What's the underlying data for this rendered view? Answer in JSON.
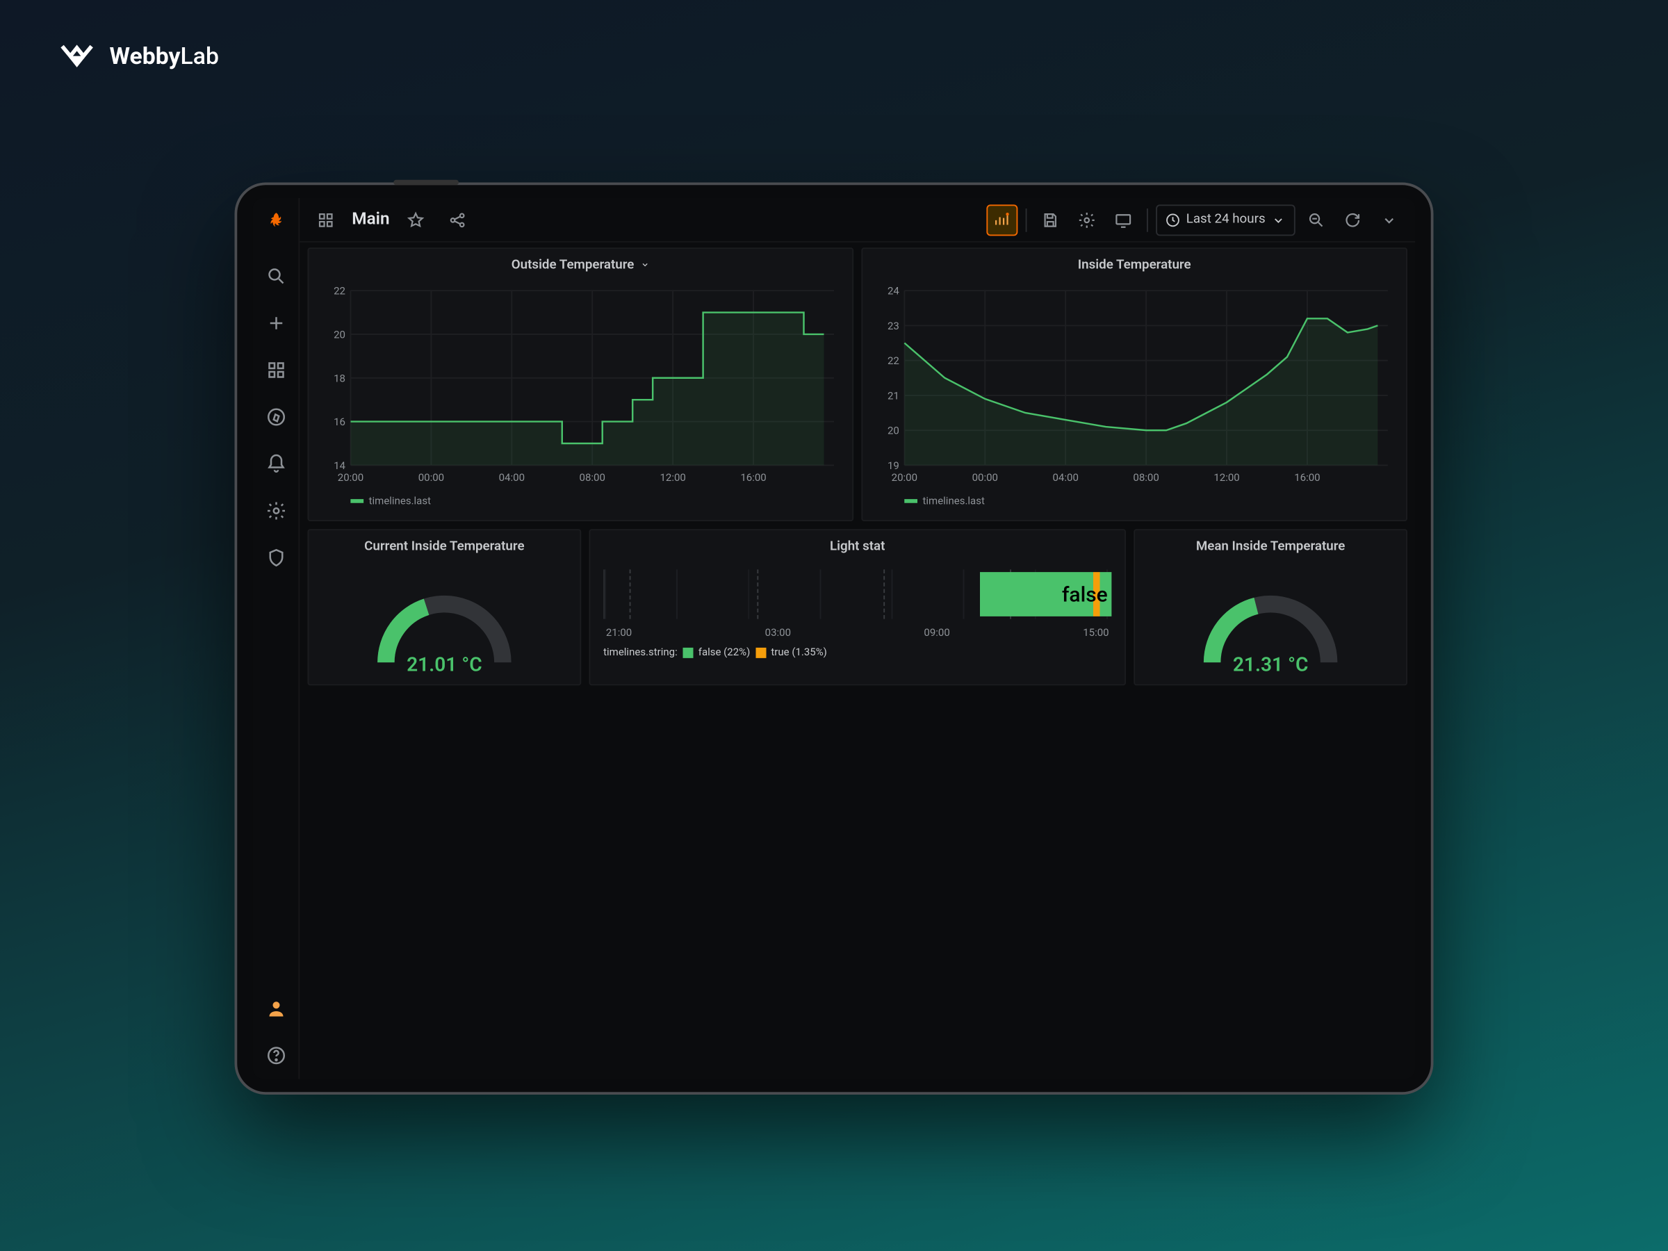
{
  "brand": {
    "name_bold": "Webby",
    "name_light": "Lab"
  },
  "topbar": {
    "title": "Main",
    "time_label": "Last 24 hours"
  },
  "rail": {
    "items": [
      "search",
      "add",
      "apps",
      "compass",
      "bell",
      "gear",
      "shield"
    ],
    "bottom": [
      "user",
      "help"
    ]
  },
  "panels": {
    "outside": {
      "title": "Outside Temperature",
      "legend": "timelines.last"
    },
    "inside": {
      "title": "Inside Temperature",
      "legend": "timelines.last"
    },
    "current": {
      "title": "Current Inside Temperature",
      "value": "21.01 °C"
    },
    "light": {
      "title": "Light stat",
      "big_label": "false",
      "x": [
        "21:00",
        "03:00",
        "09:00",
        "15:00"
      ],
      "legend_prefix": "timelines.string:",
      "legend_false": "false (22%)",
      "legend_true": "true (1.35%)"
    },
    "mean": {
      "title": "Mean Inside Temperature",
      "value": "21.31 °C"
    }
  },
  "chart_data": [
    {
      "type": "line",
      "title": "Outside Temperature",
      "xlabel": "",
      "ylabel": "",
      "ylim": [
        14,
        22
      ],
      "x_ticks": [
        "20:00",
        "00:00",
        "04:00",
        "08:00",
        "12:00",
        "16:00"
      ],
      "series": [
        {
          "name": "timelines.last",
          "x": [
            "20:00",
            "22:30",
            "22:30",
            "06:30",
            "06:30",
            "08:30",
            "08:30",
            "10:00",
            "10:00",
            "11:00",
            "11:00",
            "13:30",
            "13:30",
            "18:30",
            "18:30",
            "19:30"
          ],
          "values": [
            16,
            16,
            16,
            16,
            15,
            15,
            16,
            16,
            17,
            17,
            18,
            18,
            21,
            21,
            20,
            20
          ]
        }
      ]
    },
    {
      "type": "line",
      "title": "Inside Temperature",
      "xlabel": "",
      "ylabel": "",
      "ylim": [
        19,
        24
      ],
      "x_ticks": [
        "20:00",
        "00:00",
        "04:00",
        "08:00",
        "12:00",
        "16:00"
      ],
      "series": [
        {
          "name": "timelines.last",
          "x": [
            "20:00",
            "22:00",
            "00:00",
            "02:00",
            "04:00",
            "06:00",
            "08:00",
            "09:00",
            "10:00",
            "11:00",
            "12:00",
            "13:00",
            "14:00",
            "15:00",
            "16:00",
            "17:00",
            "18:00",
            "19:00",
            "19:30"
          ],
          "values": [
            22.5,
            21.5,
            20.9,
            20.5,
            20.3,
            20.1,
            20.0,
            20.0,
            20.2,
            20.5,
            20.8,
            21.2,
            21.6,
            22.1,
            23.2,
            23.2,
            22.8,
            22.9,
            23.0
          ]
        }
      ]
    },
    {
      "type": "area",
      "title": "Light stat",
      "categories": [
        "21:00",
        "03:00",
        "09:00",
        "15:00"
      ],
      "series": [
        {
          "name": "false",
          "percent": 22
        },
        {
          "name": "true",
          "percent": 1.35
        }
      ],
      "current": "false"
    }
  ],
  "gauges": {
    "current": {
      "min": 15,
      "max": 30,
      "value": 21.01
    },
    "mean": {
      "min": 15,
      "max": 30,
      "value": 21.31
    }
  },
  "colors": {
    "accent": "#4ac26b",
    "warn": "#f59e0b",
    "grafana": "#f46800"
  }
}
